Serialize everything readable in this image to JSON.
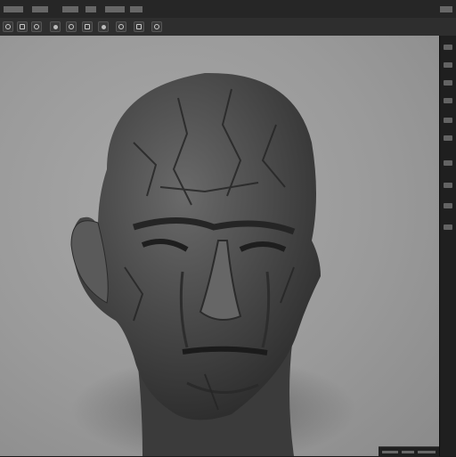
{
  "app": {
    "menu_items": [
      "menu-1",
      "menu-2",
      "menu-3",
      "menu-4",
      "menu-5",
      "menu-6",
      "menu-7"
    ]
  },
  "toolbar": {
    "tools": [
      {
        "icon": "view-icon"
      },
      {
        "icon": "move-icon"
      },
      {
        "icon": "rotate-icon"
      },
      {
        "icon": "scale-icon"
      },
      {
        "icon": "brush-icon"
      },
      {
        "icon": "material-icon"
      },
      {
        "icon": "light-icon"
      },
      {
        "icon": "render-icon"
      },
      {
        "icon": "layers-icon"
      },
      {
        "icon": "settings-icon"
      }
    ]
  },
  "viewport": {
    "subject": "sculpted-stone-head-model",
    "colors": {
      "background": "#9e9e9e",
      "model": "#4a4a4a"
    }
  },
  "right_panel": {
    "items": [
      "panel-item-1",
      "panel-item-2",
      "panel-item-3",
      "panel-item-4",
      "panel-item-5",
      "panel-item-6",
      "panel-item-7",
      "panel-item-8",
      "panel-item-9",
      "panel-item-10"
    ]
  }
}
